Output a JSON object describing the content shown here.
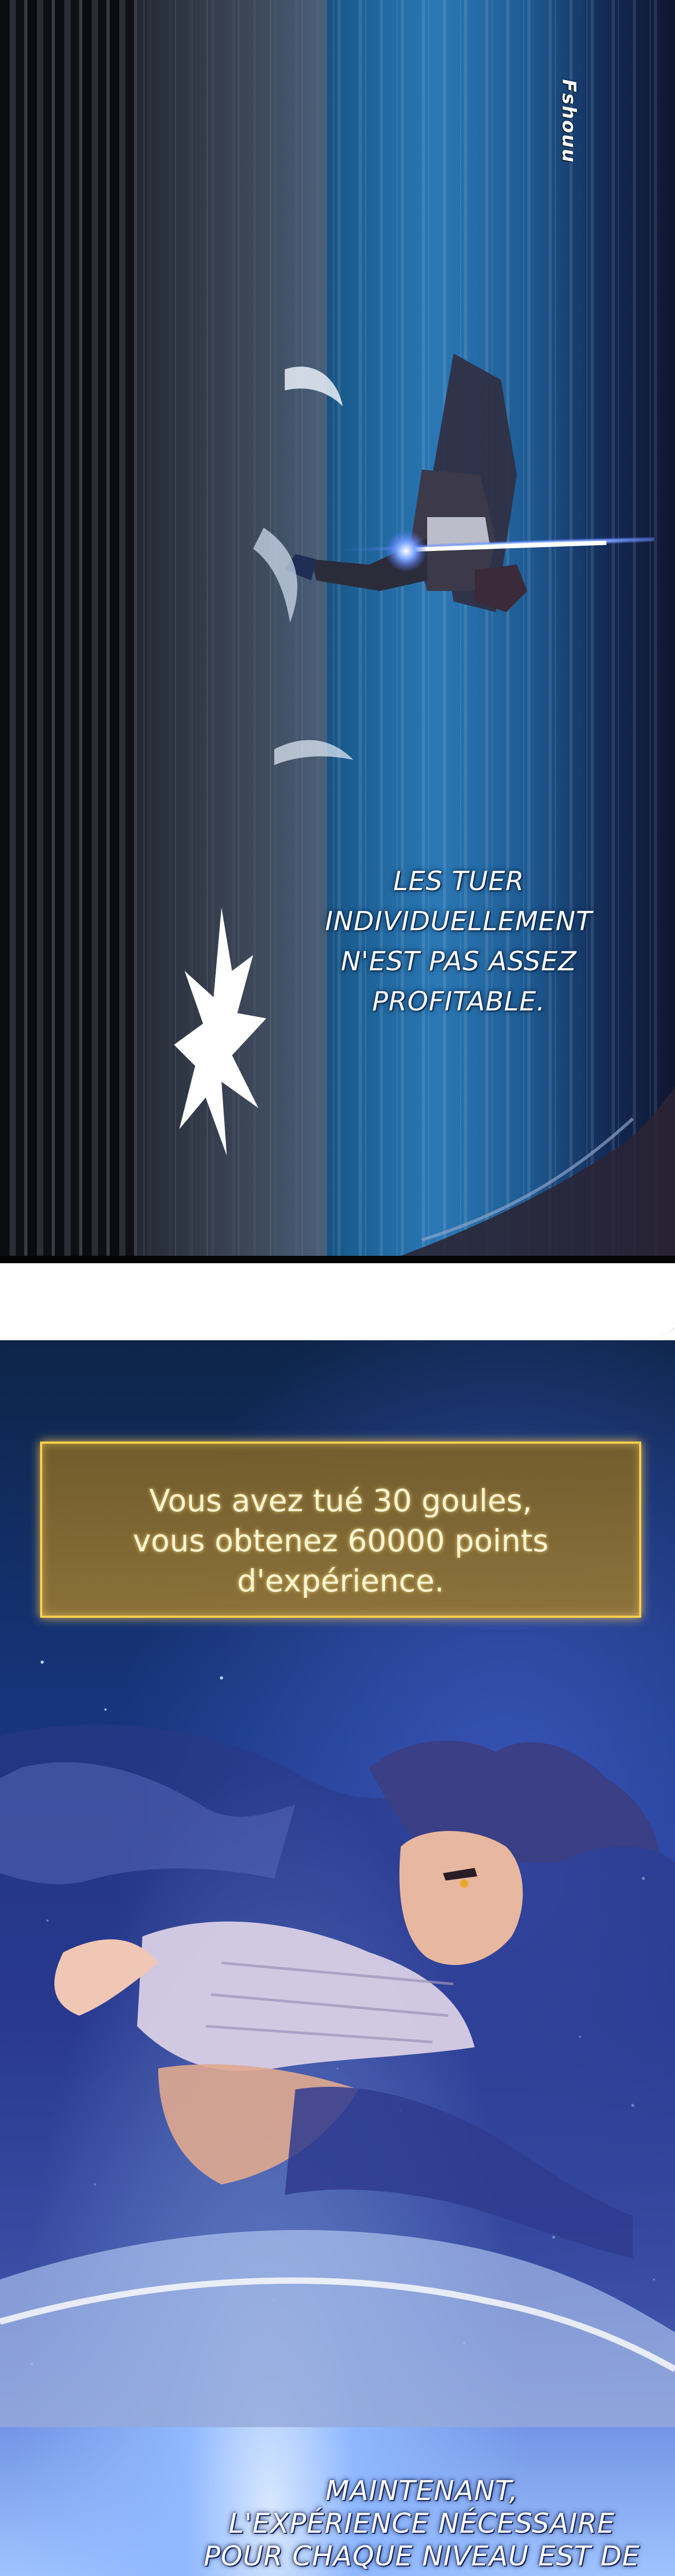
{
  "sfx": {
    "text": "Fshouu"
  },
  "captions": {
    "first": [
      "LES TUER",
      "INDIVIDUELLEMENT",
      "N'EST PAS ASSEZ",
      "PROFITABLE."
    ],
    "second": [
      "MAINTENANT,",
      "L'EXPÉRIENCE NÉCESSAIRE",
      "POUR CHAQUE NIVEAU EST DE"
    ]
  },
  "system_message": {
    "lines": [
      "Vous avez tué 30 goules,",
      "vous obtenez 60000 points",
      "d'expérience."
    ]
  },
  "colors": {
    "system_border": "#ffd04a",
    "system_text": "#fff6d4",
    "speed_blue": "#2b78b5",
    "night_blue": "#16357c"
  }
}
